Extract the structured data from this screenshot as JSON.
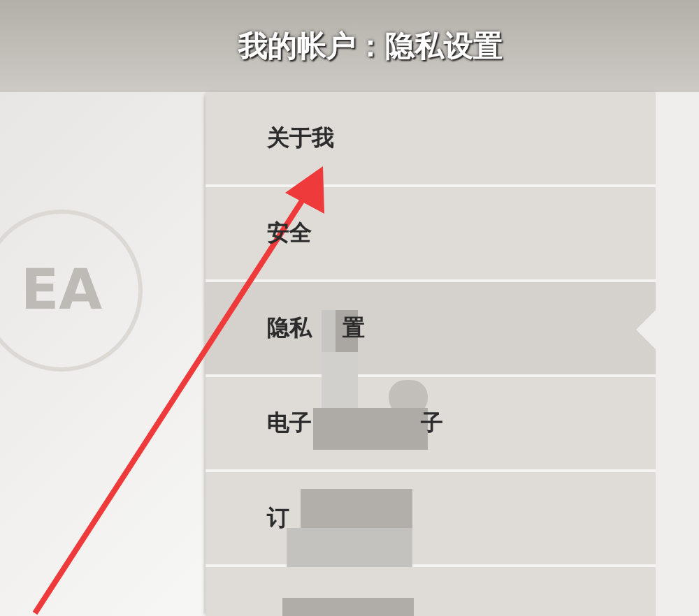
{
  "header": {
    "title": "我的帐户：隐私设置",
    "logo_text": "EA"
  },
  "menu": [
    {
      "parts": [
        "关于我"
      ],
      "selected": false
    },
    {
      "parts": [
        "安全"
      ],
      "selected": false
    },
    {
      "parts": [
        "隐私",
        "置"
      ],
      "selected": true
    },
    {
      "parts": [
        "电子",
        "子"
      ],
      "selected": false
    },
    {
      "parts": [
        "订"
      ],
      "selected": false
    },
    {
      "selected": false
    }
  ]
}
